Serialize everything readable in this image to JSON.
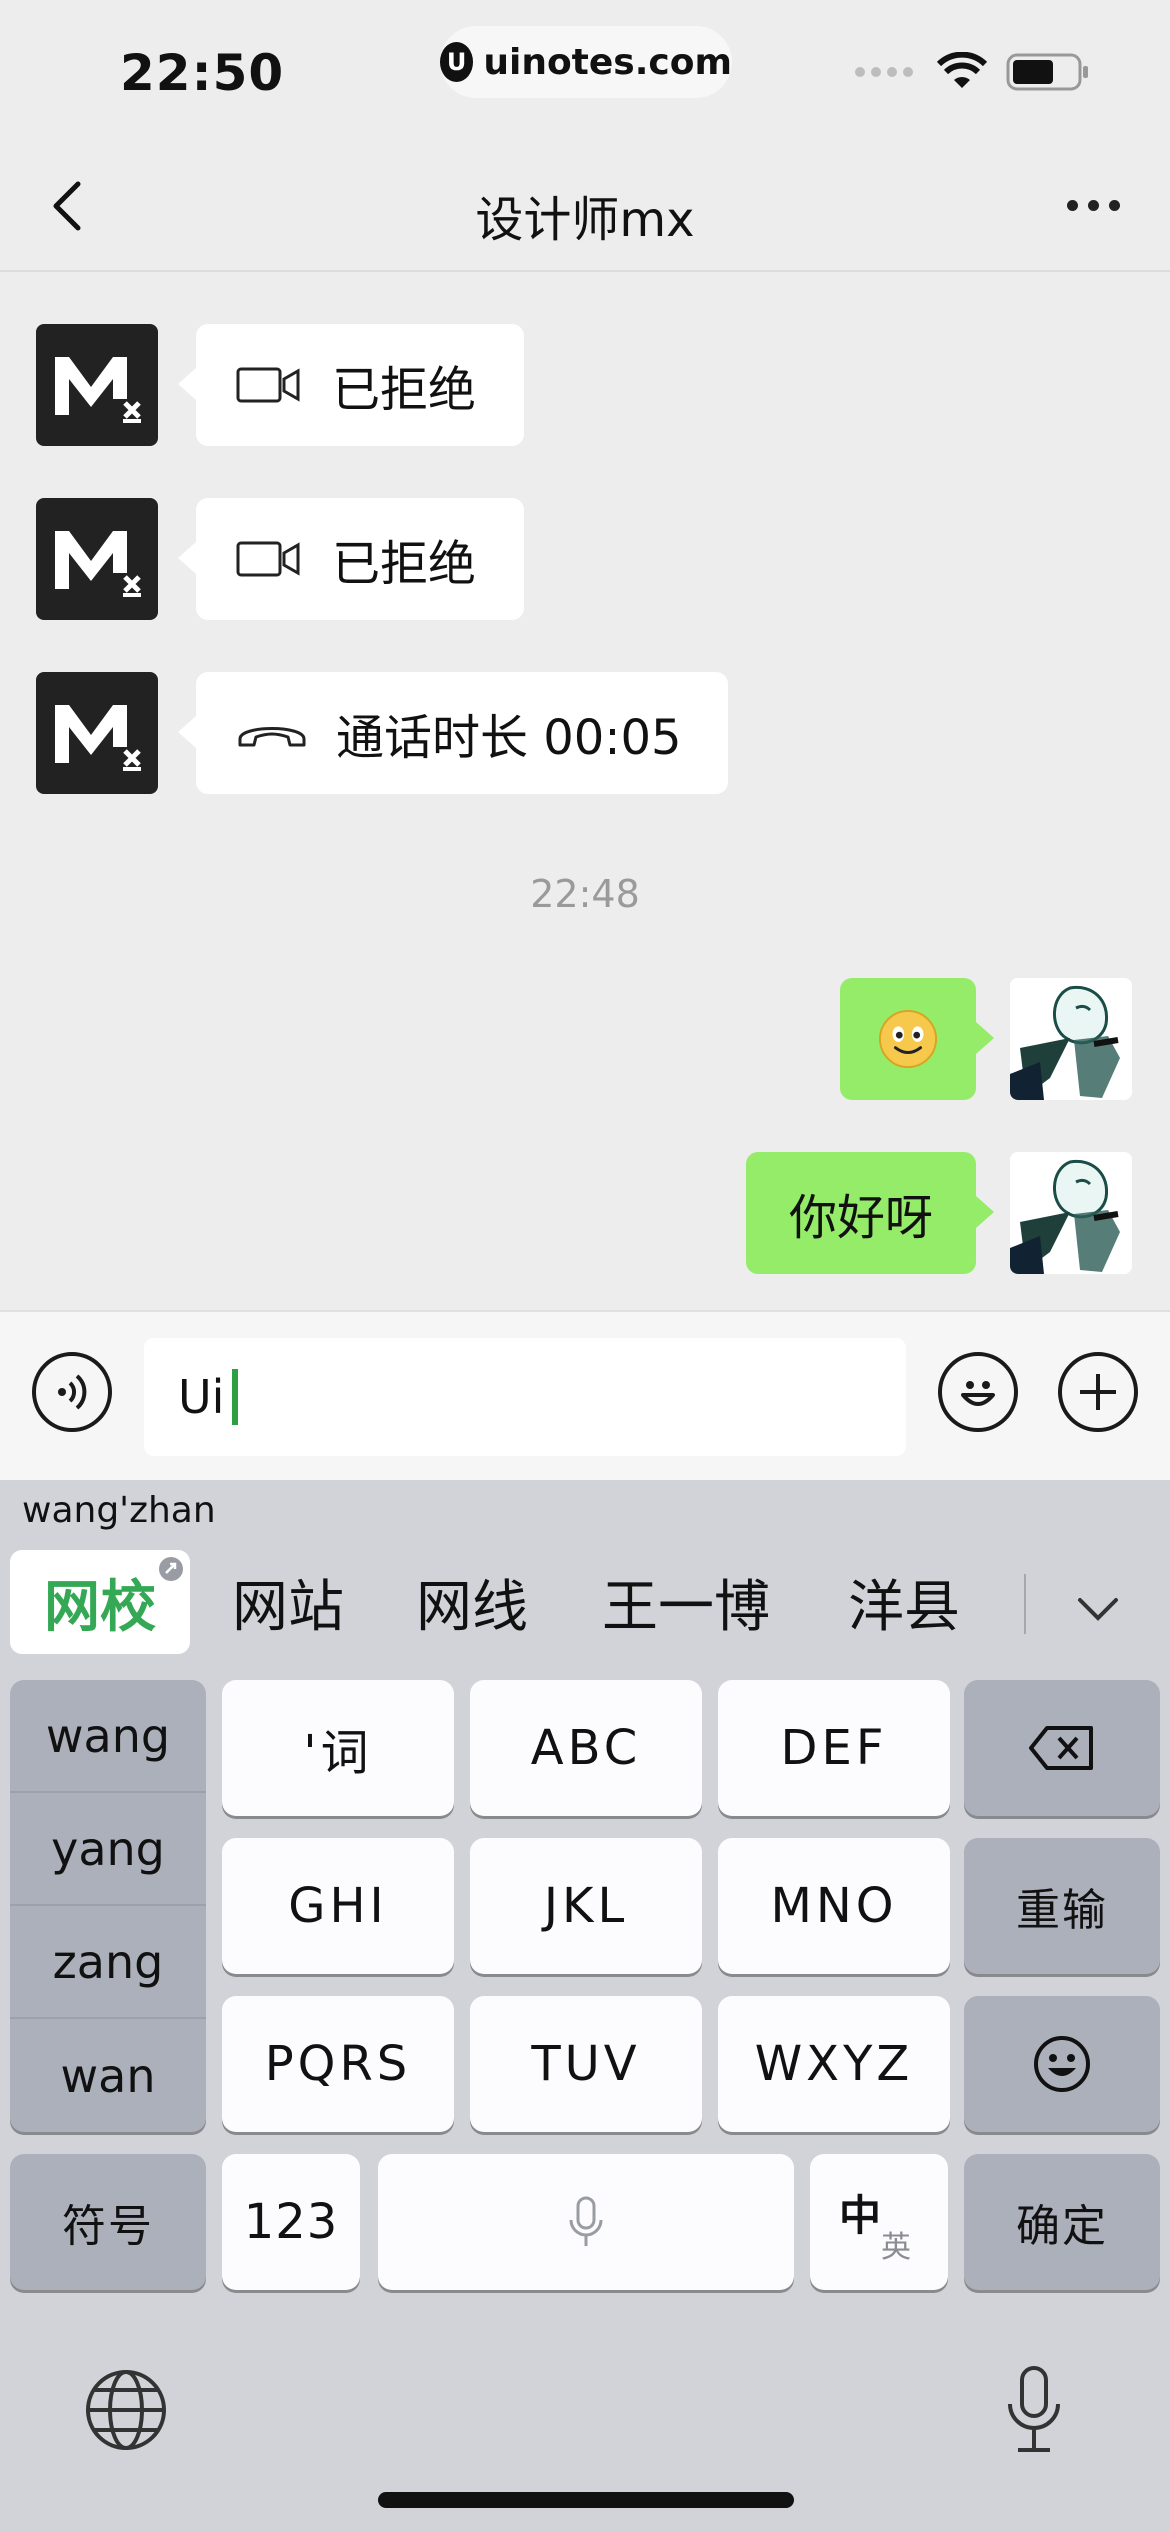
{
  "status_bar": {
    "time": "22:50",
    "url": "uinotes.com"
  },
  "nav": {
    "title": "设计师mx"
  },
  "messages": [
    {
      "side": "left",
      "icon": "video-icon",
      "text": "已拒绝"
    },
    {
      "side": "left",
      "icon": "video-icon",
      "text": "已拒绝"
    },
    {
      "side": "left",
      "icon": "phone-hangup-icon",
      "text": "通话时长 00:05"
    },
    {
      "side": "right",
      "text": "🙂"
    },
    {
      "side": "right",
      "text": "你好呀"
    }
  ],
  "timestamp": "22:48",
  "input": {
    "value": "Ui"
  },
  "keyboard": {
    "composition": "wang'zhan",
    "candidates": [
      "网校",
      "网站",
      "网线",
      "王一博",
      "洋县"
    ],
    "pinyin_options": [
      "wang",
      "yang",
      "zang",
      "wan"
    ],
    "keys": {
      "k1": "'词",
      "k2": "ABC",
      "k3": "DEF",
      "k4": "GHI",
      "k5": "JKL",
      "k6": "MNO",
      "k7": "PQRS",
      "k8": "TUV",
      "k9": "WXYZ",
      "retype": "重输",
      "symbols": "符号",
      "numbers": "123",
      "lang_main": "中",
      "lang_alt": "英",
      "confirm": "确定"
    }
  },
  "colors": {
    "accent_green": "#95ec69",
    "candidate_green": "#35a855",
    "keyboard_bg": "#d1d3d9"
  }
}
